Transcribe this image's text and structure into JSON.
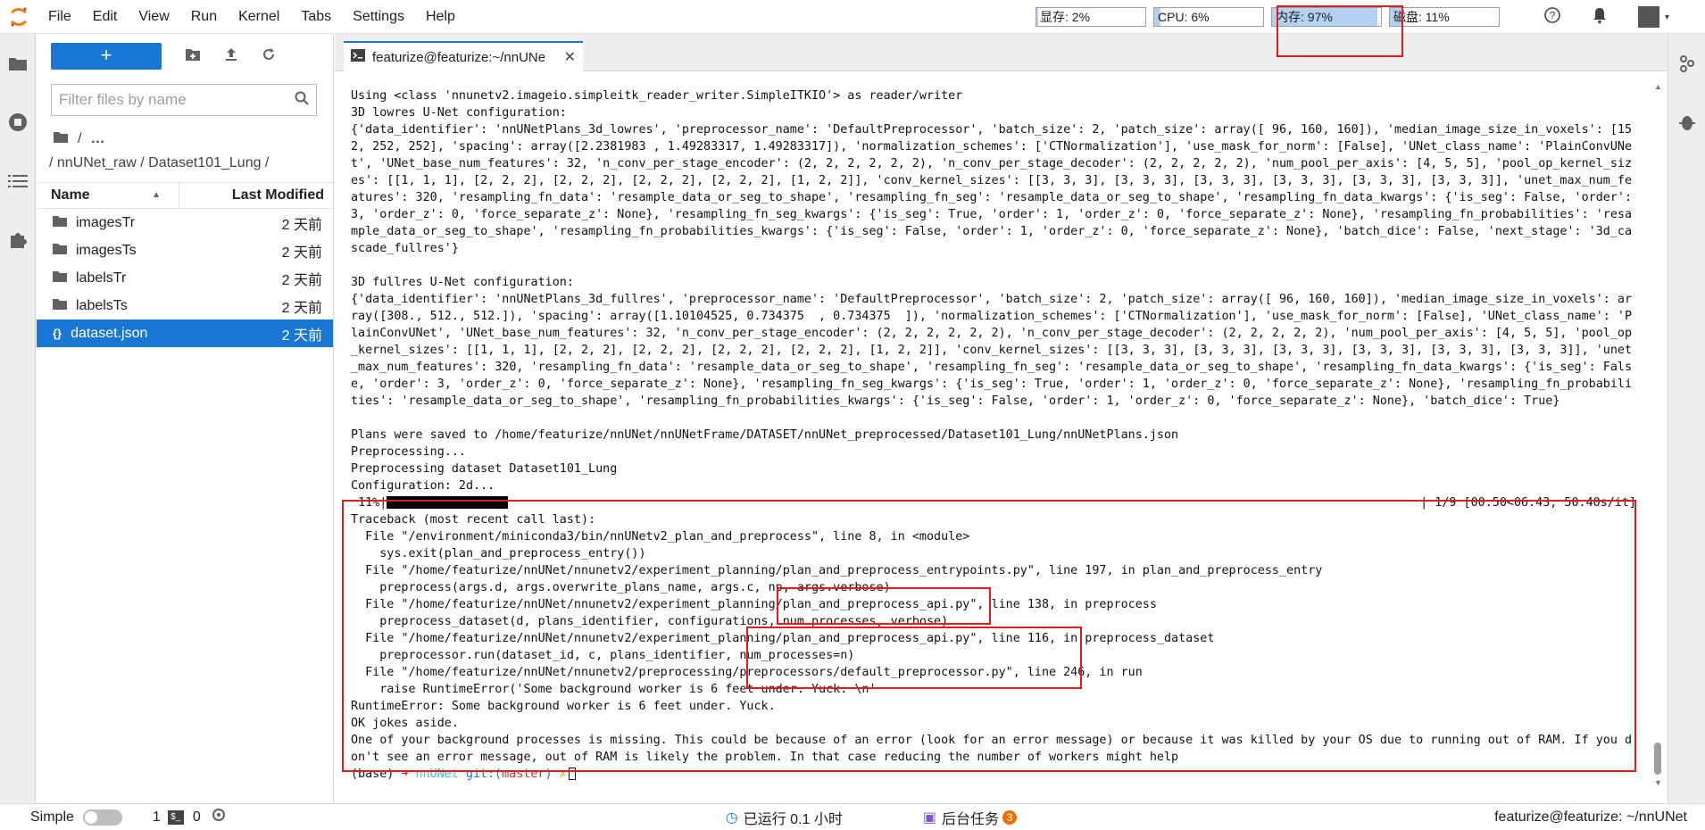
{
  "menu": [
    "File",
    "Edit",
    "View",
    "Run",
    "Kernel",
    "Tabs",
    "Settings",
    "Help"
  ],
  "resources": [
    {
      "label": "显存: 2%",
      "fill": 0.02
    },
    {
      "label": "CPU: 6%",
      "fill": 0.06
    },
    {
      "label": "内存: 97%",
      "fill": 0.97
    },
    {
      "label": "磁盘: 11%",
      "fill": 0.11
    }
  ],
  "filebrowser": {
    "new_label": "+",
    "filter_placeholder": "Filter files by name",
    "crumb_root": "/",
    "crumb_more": "…",
    "path": "/ nnUNet_raw / Dataset101_Lung /",
    "col_name": "Name",
    "col_modified": "Last Modified",
    "files": [
      {
        "name": "imagesTr",
        "modified": "2 天前",
        "type": "folder"
      },
      {
        "name": "imagesTs",
        "modified": "2 天前",
        "type": "folder"
      },
      {
        "name": "labelsTr",
        "modified": "2 天前",
        "type": "folder"
      },
      {
        "name": "labelsTs",
        "modified": "2 天前",
        "type": "folder"
      },
      {
        "name": "dataset.json",
        "modified": "2 天前",
        "type": "json"
      }
    ]
  },
  "tab": {
    "title": "featurize@featurize:~/nnUNe"
  },
  "terminal": {
    "lines": [
      "Using <class 'nnunetv2.imageio.simpleitk_reader_writer.SimpleITKIO'> as reader/writer",
      "3D lowres U-Net configuration:",
      "{'data_identifier': 'nnUNetPlans_3d_lowres', 'preprocessor_name': 'DefaultPreprocessor', 'batch_size': 2, 'patch_size': array([ 96, 160, 160]), 'median_image_size_in_voxels': [152, 252, 252], 'spacing': array([2.2381983 , 1.49283317, 1.49283317]), 'normalization_schemes': ['CTNormalization'], 'use_mask_for_norm': [False], 'UNet_class_name': 'PlainConvUNet', 'UNet_base_num_features': 32, 'n_conv_per_stage_encoder': (2, 2, 2, 2, 2, 2), 'n_conv_per_stage_decoder': (2, 2, 2, 2, 2), 'num_pool_per_axis': [4, 5, 5], 'pool_op_kernel_sizes': [[1, 1, 1], [2, 2, 2], [2, 2, 2], [2, 2, 2], [2, 2, 2], [1, 2, 2]], 'conv_kernel_sizes': [[3, 3, 3], [3, 3, 3], [3, 3, 3], [3, 3, 3], [3, 3, 3], [3, 3, 3]], 'unet_max_num_features': 320, 'resampling_fn_data': 'resample_data_or_seg_to_shape', 'resampling_fn_seg': 'resample_data_or_seg_to_shape', 'resampling_fn_data_kwargs': {'is_seg': False, 'order': 3, 'order_z': 0, 'force_separate_z': None}, 'resampling_fn_seg_kwargs': {'is_seg': True, 'order': 1, 'order_z': 0, 'force_separate_z': None}, 'resampling_fn_probabilities': 'resample_data_or_seg_to_shape', 'resampling_fn_probabilities_kwargs': {'is_seg': False, 'order': 1, 'order_z': 0, 'force_separate_z': None}, 'batch_dice': False, 'next_stage': '3d_cascade_fullres'}",
      "",
      "3D fullres U-Net configuration:",
      "{'data_identifier': 'nnUNetPlans_3d_fullres', 'preprocessor_name': 'DefaultPreprocessor', 'batch_size': 2, 'patch_size': array([ 96, 160, 160]), 'median_image_size_in_voxels': array([308., 512., 512.]), 'spacing': array([1.10104525, 0.734375  , 0.734375  ]), 'normalization_schemes': ['CTNormalization'], 'use_mask_for_norm': [False], 'UNet_class_name': 'PlainConvUNet', 'UNet_base_num_features': 32, 'n_conv_per_stage_encoder': (2, 2, 2, 2, 2, 2), 'n_conv_per_stage_decoder': (2, 2, 2, 2, 2), 'num_pool_per_axis': [4, 5, 5], 'pool_op_kernel_sizes': [[1, 1, 1], [2, 2, 2], [2, 2, 2], [2, 2, 2], [2, 2, 2], [1, 2, 2]], 'conv_kernel_sizes': [[3, 3, 3], [3, 3, 3], [3, 3, 3], [3, 3, 3], [3, 3, 3], [3, 3, 3]], 'unet_max_num_features': 320, 'resampling_fn_data': 'resample_data_or_seg_to_shape', 'resampling_fn_seg': 'resample_data_or_seg_to_shape', 'resampling_fn_data_kwargs': {'is_seg': False, 'order': 3, 'order_z': 0, 'force_separate_z': None}, 'resampling_fn_seg_kwargs': {'is_seg': True, 'order': 1, 'order_z': 0, 'force_separate_z': None}, 'resampling_fn_probabilities': 'resample_data_or_seg_to_shape', 'resampling_fn_probabilities_kwargs': {'is_seg': False, 'order': 1, 'order_z': 0, 'force_separate_z': None}, 'batch_dice': True}",
      "",
      "Plans were saved to /home/featurize/nnUNet/nnUNetFrame/DATASET/nnUNet_preprocessed/Dataset101_Lung/nnUNetPlans.json",
      "Preprocessing...",
      "Preprocessing dataset Dataset101_Lung",
      "Configuration: 2d...",
      " 11%|",
      "Traceback (most recent call last):",
      "  File \"/environment/miniconda3/bin/nnUNetv2_plan_and_preprocess\", line 8, in <module>",
      "    sys.exit(plan_and_preprocess_entry())",
      "  File \"/home/featurize/nnUNet/nnunetv2/experiment_planning/plan_and_preprocess_entrypoints.py\", line 197, in plan_and_preprocess_entry",
      "    preprocess(args.d, args.overwrite_plans_name, args.c, np, args.verbose)",
      "  File \"/home/featurize/nnUNet/nnunetv2/experiment_planning/plan_and_preprocess_api.py\", line 138, in preprocess",
      "    preprocess_dataset(d, plans_identifier, configurations, num_processes, verbose)",
      "  File \"/home/featurize/nnUNet/nnunetv2/experiment_planning/plan_and_preprocess_api.py\", line 116, in preprocess_dataset",
      "    preprocessor.run(dataset_id, c, plans_identifier, num_processes=n)",
      "  File \"/home/featurize/nnUNet/nnunetv2/preprocessing/preprocessors/default_preprocessor.py\", line 246, in run",
      "    raise RuntimeError('Some background worker is 6 feet under. Yuck. \\n'",
      "RuntimeError: Some background worker is 6 feet under. Yuck.",
      "OK jokes aside.",
      "One of your background processes is missing. This could be because of an error (look for an error message) or because it was killed by your OS due to running out of RAM. If you don't see an error message, out of RAM is likely the problem. In that case reducing the number of workers might help"
    ],
    "progress_right": "| 1/9 [00:50<06:43, 50.40s/it]",
    "prompt_base": "(base)",
    "prompt_arrow": "➜",
    "prompt_dir": "nnUNet",
    "prompt_git": "git:(",
    "prompt_branch": "master",
    "prompt_git_close": ")",
    "prompt_mark": "✗"
  },
  "statusbar": {
    "mode_label": "Simple",
    "count1": "1",
    "count2": "0",
    "running": "已运行 0.1 小时",
    "tasks": "后台任务",
    "tasks_count": "3",
    "right": "featurize@featurize: ~/nnUNet"
  },
  "colors": {
    "accent": "#1976d2",
    "highlight": "#e21c1c",
    "prompt_green": "#26c6da",
    "prompt_red": "#d32f2f"
  }
}
